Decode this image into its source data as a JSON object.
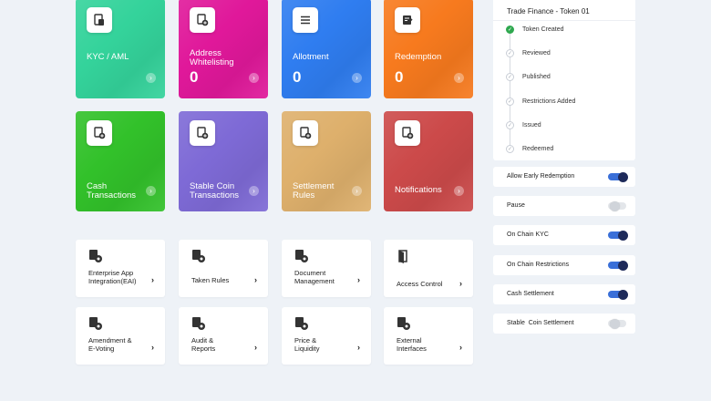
{
  "tiles": [
    {
      "title": "KYC / AML",
      "count": "",
      "color": "#34d39b"
    },
    {
      "title": "Address Whitelisting",
      "count": "0",
      "color": "#e0189a"
    },
    {
      "title": "Allotment",
      "count": "0",
      "color": "#2f7df0"
    },
    {
      "title": "Redemption",
      "count": "0",
      "color": "#f77a1e"
    },
    {
      "title": "Cash Transactions",
      "count": "",
      "color": "#32c12a"
    },
    {
      "title": "Stable Coin Transactions",
      "count": "",
      "color": "#7e6ad6"
    },
    {
      "title": "Settlement Rules",
      "count": "",
      "color": "#deb06c"
    },
    {
      "title": "Notifications",
      "count": "",
      "color": "#cc4a4a"
    }
  ],
  "cards": [
    {
      "label": "Enterprise App Integration(EAI)",
      "arrow": "›"
    },
    {
      "label": "Taken Rules",
      "arrow": "›"
    },
    {
      "label": "Document Management",
      "arrow": "›"
    },
    {
      "label": "Access Control",
      "arrow": "›"
    },
    {
      "label": "Amendment & E-Voting",
      "arrow": "›"
    },
    {
      "label": "Audit & Reports",
      "arrow": "›"
    },
    {
      "label": "Price & Liquidity",
      "arrow": "›"
    },
    {
      "label": "External Interfaces",
      "arrow": "›"
    }
  ],
  "status": {
    "title": "Trade Finance - Token 01",
    "steps": [
      {
        "label": "Token Created",
        "done": true
      },
      {
        "label": "Reviewed",
        "done": false
      },
      {
        "label": "Published",
        "done": false
      },
      {
        "label": "Restrictions Added",
        "done": false
      },
      {
        "label": "Issued",
        "done": false
      },
      {
        "label": "Redeemed",
        "done": false
      }
    ]
  },
  "toggles": [
    {
      "label": "Allow Early Redemption",
      "on": true
    },
    {
      "label": "Pause",
      "on": false
    },
    {
      "label": "On Chain KYC",
      "on": true
    },
    {
      "label": "On Chain Restrictions",
      "on": true
    },
    {
      "label": "Cash Settlement",
      "on": true
    },
    {
      "label": "Stable  Coin Settlement",
      "on": false
    }
  ]
}
